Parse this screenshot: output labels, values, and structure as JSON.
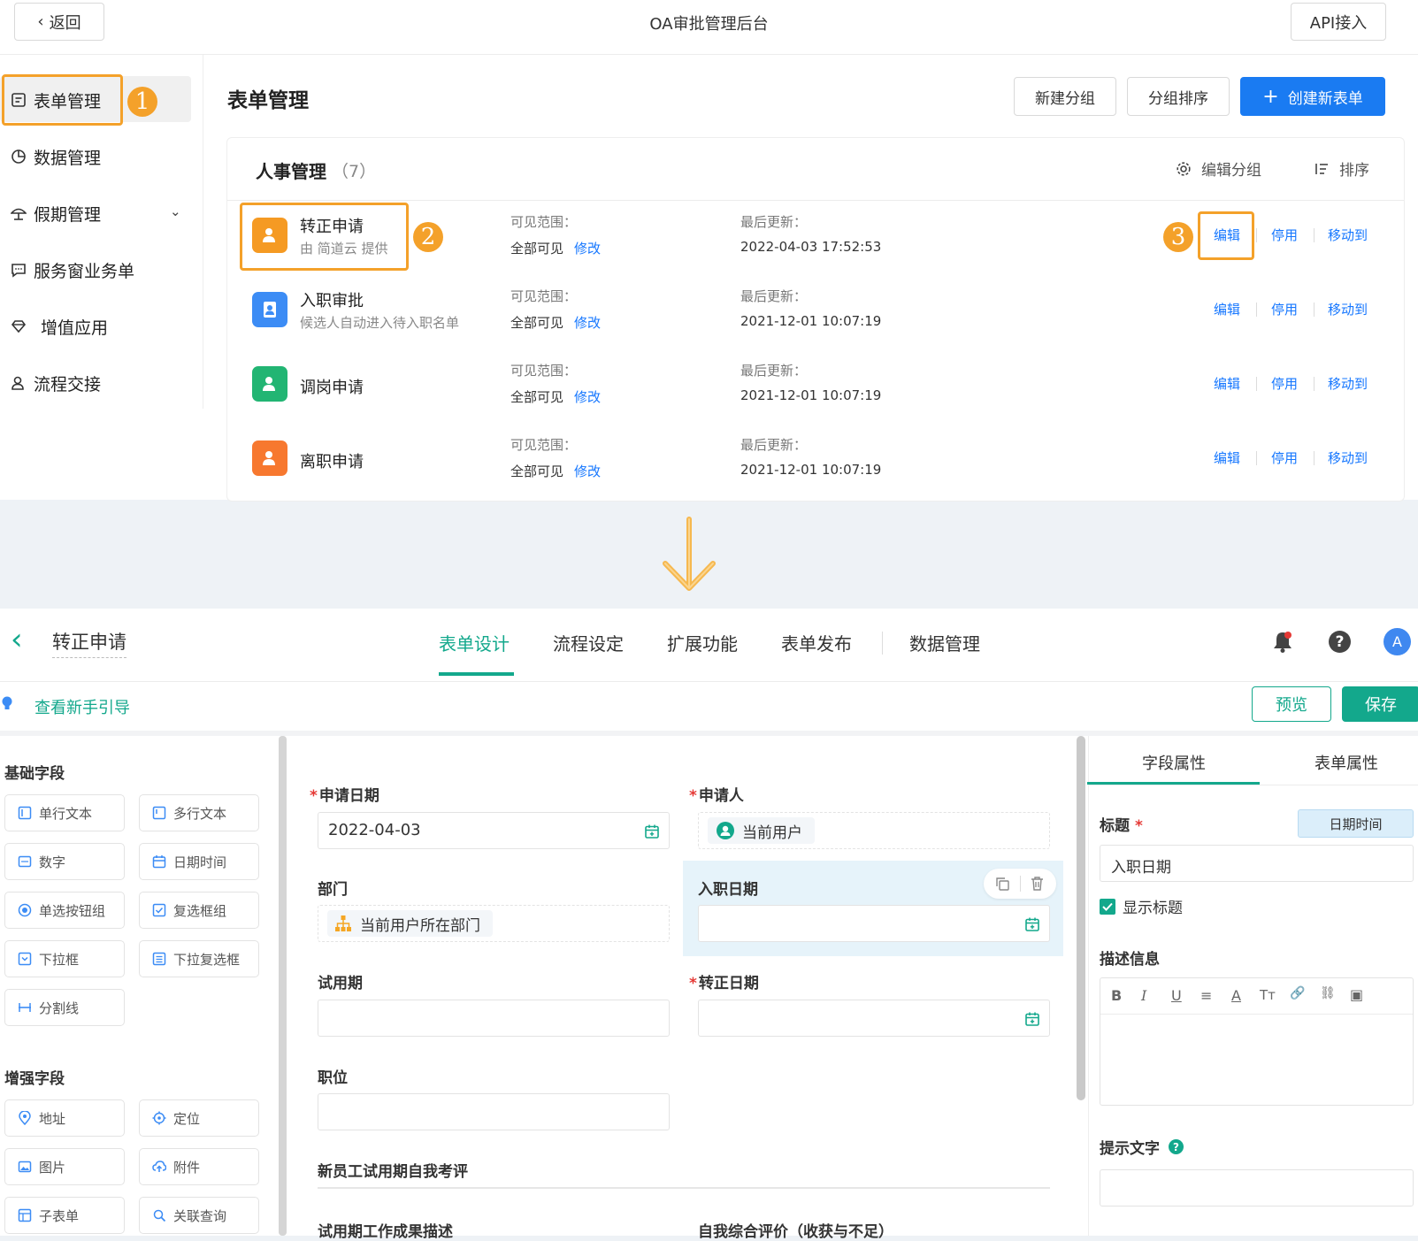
{
  "header": {
    "back": "返回",
    "title": "OA审批管理后台",
    "api": "API接入"
  },
  "nav": [
    {
      "label": "表单管理",
      "icon": "form-icon"
    },
    {
      "label": "数据管理",
      "icon": "pie-chart-icon"
    },
    {
      "label": "假期管理",
      "icon": "umbrella-icon"
    },
    {
      "label": "服务窗业务单",
      "icon": "message-icon"
    },
    {
      "label": "增值应用",
      "icon": "diamond-icon"
    },
    {
      "label": "流程交接",
      "icon": "user-icon"
    }
  ],
  "badges": [
    "1",
    "2",
    "3"
  ],
  "main": {
    "title": "表单管理",
    "new_group": "新建分组",
    "sort_group": "分组排序",
    "create": "创建新表单",
    "create_icon": "plus-icon"
  },
  "group": {
    "name": "人事管理",
    "count": "（7）",
    "edit_group": "编辑分组",
    "sort": "排序"
  },
  "forms": [
    {
      "name": "转正申请",
      "desc": "由 简道云 提供",
      "scope_label": "可见范围：",
      "scope": "全部可见",
      "modify": "修改",
      "updated_label": "最后更新：",
      "updated": "2022-04-03 17:52:53",
      "color": "#f59a23"
    },
    {
      "name": "入职审批",
      "desc": "候选人自动进入待入职名单",
      "scope_label": "可见范围：",
      "scope": "全部可见",
      "modify": "修改",
      "updated_label": "最后更新：",
      "updated": "2021-12-01 10:07:19",
      "color": "#3c8cf5"
    },
    {
      "name": "调岗申请",
      "desc": "",
      "scope_label": "可见范围：",
      "scope": "全部可见",
      "modify": "修改",
      "updated_label": "最后更新：",
      "updated": "2021-12-01 10:07:19",
      "color": "#22b573"
    },
    {
      "name": "离职申请",
      "desc": "",
      "scope_label": "可见范围：",
      "scope": "全部可见",
      "modify": "修改",
      "updated_label": "最后更新：",
      "updated": "2021-12-01 10:07:19",
      "color": "#f7782f"
    }
  ],
  "actions": {
    "edit": "编辑",
    "disable": "停用",
    "move": "移动到"
  },
  "designer": {
    "back_title": "转正申请",
    "tabs": [
      "表单设计",
      "流程设定",
      "扩展功能",
      "表单发布",
      "数据管理"
    ],
    "guide": "查看新手引导",
    "preview": "预览",
    "save": "保存",
    "avatar": "A",
    "basic_title": "基础字段",
    "basic": [
      "单行文本",
      "多行文本",
      "数字",
      "日期时间",
      "单选按钮组",
      "复选框组",
      "下拉框",
      "下拉复选框",
      "分割线"
    ],
    "enhanced_title": "增强字段",
    "enhanced": [
      "地址",
      "定位",
      "图片",
      "附件",
      "子表单",
      "关联查询"
    ],
    "fields": {
      "apply_date": "申请日期",
      "apply_date_val": "2022-04-03",
      "applicant": "申请人",
      "applicant_val": "当前用户",
      "dept": "部门",
      "dept_val": "当前用户所在部门",
      "entry_date": "入职日期",
      "probation": "试用期",
      "regular_date": "转正日期",
      "position": "职位",
      "section": "新员工试用期自我考评",
      "work_desc": "试用期工作成果描述",
      "self_eval": "自我综合评价（收获与不足）"
    },
    "props": {
      "tab_field": "字段属性",
      "tab_form": "表单属性",
      "title_label": "标题",
      "type_tag": "日期时间",
      "title_val": "入职日期",
      "show_title": "显示标题",
      "desc_label": "描述信息",
      "hint_label": "提示文字"
    },
    "toolbar": [
      "B",
      "I",
      "U",
      "≡",
      "A",
      "Tт",
      "🔗",
      "⛓",
      "▣"
    ]
  }
}
